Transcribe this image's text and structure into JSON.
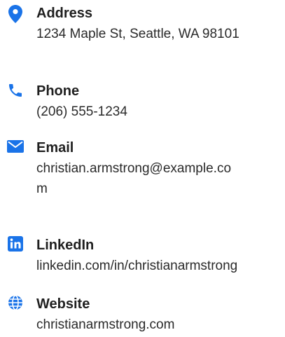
{
  "accent_color": "#1a73e8",
  "contact": {
    "address": {
      "icon": "map-pin-icon",
      "label": "Address",
      "value": "1234 Maple St, Seattle, WA 98101"
    },
    "phone": {
      "icon": "phone-icon",
      "label": "Phone",
      "value": "(206) 555-1234"
    },
    "email": {
      "icon": "envelope-icon",
      "label": "Email",
      "value": "christian.armstrong@example.com"
    },
    "linkedin": {
      "icon": "linkedin-icon",
      "label": "LinkedIn",
      "value": "linkedin.com/in/christianarmstrong"
    },
    "website": {
      "icon": "globe-icon",
      "label": "Website",
      "value": "christianarmstrong.com"
    }
  }
}
